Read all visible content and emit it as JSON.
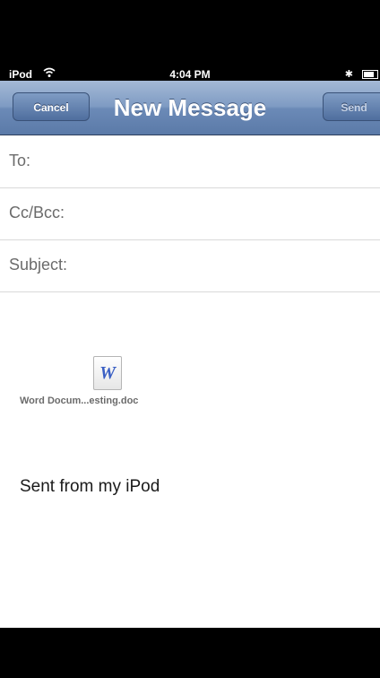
{
  "status_bar": {
    "carrier": "iPod",
    "time": "4:04 PM",
    "bluetooth_icon": "bluetooth-icon",
    "wifi_icon": "wifi-icon",
    "battery_icon": "battery-icon"
  },
  "nav": {
    "title": "New Message",
    "cancel_label": "Cancel",
    "send_label": "Send"
  },
  "fields": {
    "to_label": "To:",
    "cc_label": "Cc/Bcc:",
    "subject_label": "Subject:"
  },
  "attachment": {
    "icon_letter": "W",
    "name": "Word Docum...esting.doc"
  },
  "body": {
    "signature": "Sent from my iPod"
  },
  "colors": {
    "nav_bar": "#6b8ab7",
    "background": "#ffffff",
    "chrome": "#000000"
  }
}
